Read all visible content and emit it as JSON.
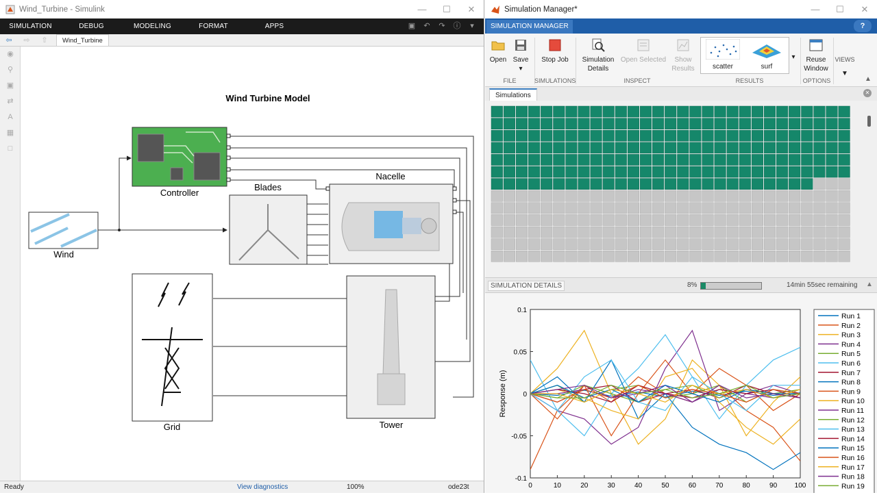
{
  "simulink": {
    "title": "Wind_Turbine - Simulink",
    "tabs": [
      "SIMULATION",
      "DEBUG",
      "MODELING",
      "FORMAT",
      "APPS"
    ],
    "breadcrumb": "Wind_Turbine",
    "model_title": "Wind Turbine Model",
    "blocks": {
      "controller": "Controller",
      "blades": "Blades",
      "nacelle": "Nacelle",
      "wind": "Wind",
      "grid": "Grid",
      "tower": "Tower"
    },
    "status": {
      "ready": "Ready",
      "diagnostics": "View diagnostics",
      "zoom": "100%",
      "solver": "ode23t"
    }
  },
  "simmgr": {
    "title": "Simulation Manager*",
    "tab": "SIMULATION MANAGER",
    "help": "?",
    "ribbon": {
      "open": "Open",
      "save": "Save",
      "stop_job": "Stop Job",
      "simulation_details_1": "Simulation",
      "simulation_details_2": "Details",
      "open_selected": "Open Selected",
      "show_results_1": "Show",
      "show_results_2": "Results",
      "scatter": "scatter",
      "surf": "surf",
      "reuse_window_1": "Reuse",
      "reuse_window_2": "Window",
      "views": "VIEWS",
      "groups": {
        "file": "FILE",
        "simulations": "SIMULATIONS",
        "inspect": "INSPECT",
        "results": "RESULTS",
        "options": "OPTIONS"
      }
    },
    "simulations_tab": "Simulations",
    "grid": {
      "rows": 13,
      "cols": 29,
      "completed": 200,
      "done_color": "#15876a",
      "pending_color": "#c6c6c6"
    },
    "details": {
      "label": "SIMULATION DETAILS",
      "percent_text": "8%",
      "progress": 0.08,
      "remaining": "14min 55sec remaining"
    }
  },
  "chart_data": {
    "type": "line",
    "title": "",
    "xlabel": "",
    "ylabel": "Response (m)",
    "xlim": [
      0,
      100
    ],
    "ylim": [
      -0.1,
      0.1
    ],
    "xticks": [
      "0",
      "10",
      "20",
      "30",
      "40",
      "50",
      "60",
      "70",
      "80",
      "90",
      "100"
    ],
    "yticks": [
      "0.1",
      "0.05",
      "0",
      "-0.05",
      "-0.1"
    ],
    "legend_position": "right",
    "series": [
      {
        "name": "Run 1",
        "color": "#0072bd",
        "x": [
          0,
          10,
          20,
          30,
          40,
          50,
          60,
          70,
          80,
          90,
          100
        ],
        "values": [
          0.0,
          -0.002,
          0.004,
          -0.003,
          0.002,
          -0.004,
          0.003,
          -0.002,
          0.003,
          -0.002,
          0.001
        ]
      },
      {
        "name": "Run 2",
        "color": "#d95319",
        "x": [
          0,
          10,
          20,
          30,
          40,
          50,
          60,
          70,
          80,
          90,
          100
        ],
        "values": [
          -0.09,
          -0.02,
          0.01,
          -0.01,
          0.02,
          0.0,
          -0.01,
          0.01,
          -0.02,
          -0.04,
          -0.08
        ]
      },
      {
        "name": "Run 3",
        "color": "#edb120",
        "x": [
          0,
          10,
          20,
          30,
          40,
          50,
          60,
          70,
          80,
          90,
          100
        ],
        "values": [
          0.0,
          0.03,
          0.075,
          0.0,
          -0.06,
          -0.03,
          0.04,
          0.01,
          -0.05,
          -0.01,
          0.02
        ]
      },
      {
        "name": "Run 4",
        "color": "#7e2f8e",
        "x": [
          0,
          10,
          20,
          30,
          40,
          50,
          60,
          70,
          80,
          90,
          100
        ],
        "values": [
          0.0,
          -0.02,
          -0.03,
          -0.06,
          -0.04,
          0.03,
          0.075,
          -0.02,
          0.0,
          0.01,
          0.0
        ]
      },
      {
        "name": "Run 5",
        "color": "#77ac30",
        "x": [
          0,
          10,
          20,
          30,
          40,
          50,
          60,
          70,
          80,
          90,
          100
        ],
        "values": [
          0.0,
          0.01,
          -0.01,
          0.005,
          0.01,
          -0.005,
          0.0,
          0.01,
          -0.01,
          0.005,
          0.0
        ]
      },
      {
        "name": "Run 6",
        "color": "#4dbeee",
        "x": [
          0,
          10,
          20,
          30,
          40,
          50,
          60,
          70,
          80,
          90,
          100
        ],
        "values": [
          0.04,
          -0.02,
          -0.05,
          0.0,
          0.03,
          0.07,
          0.02,
          -0.03,
          0.01,
          0.04,
          0.055
        ]
      },
      {
        "name": "Run 7",
        "color": "#a2142f",
        "x": [
          0,
          10,
          20,
          30,
          40,
          50,
          60,
          70,
          80,
          90,
          100
        ],
        "values": [
          0.0,
          -0.01,
          0.005,
          0.01,
          -0.01,
          0.0,
          0.005,
          -0.005,
          0.01,
          0.0,
          -0.005
        ]
      },
      {
        "name": "Run 8",
        "color": "#0072bd",
        "x": [
          0,
          10,
          20,
          30,
          40,
          50,
          60,
          70,
          80,
          90,
          100
        ],
        "values": [
          0.0,
          0.02,
          -0.01,
          0.04,
          -0.03,
          0.0,
          -0.04,
          -0.06,
          -0.07,
          -0.09,
          -0.07
        ]
      },
      {
        "name": "Run 9",
        "color": "#d95319",
        "x": [
          0,
          10,
          20,
          30,
          40,
          50,
          60,
          70,
          80,
          90,
          100
        ],
        "values": [
          0.0,
          -0.03,
          0.01,
          -0.05,
          0.0,
          0.04,
          0.0,
          0.03,
          0.01,
          -0.02,
          0.0
        ]
      },
      {
        "name": "Run 10",
        "color": "#edb120",
        "x": [
          0,
          10,
          20,
          30,
          40,
          50,
          60,
          70,
          80,
          90,
          100
        ],
        "values": [
          0.0,
          0.005,
          -0.005,
          -0.02,
          -0.03,
          0.02,
          0.03,
          -0.01,
          -0.04,
          -0.06,
          -0.03
        ]
      },
      {
        "name": "Run 11",
        "color": "#7e2f8e",
        "x": [
          0,
          10,
          20,
          30,
          40,
          50,
          60,
          70,
          80,
          90,
          100
        ],
        "values": [
          0.0,
          0.0,
          0.005,
          -0.005,
          0.0,
          0.01,
          -0.01,
          0.005,
          0.0,
          -0.005,
          0.0
        ]
      },
      {
        "name": "Run 12",
        "color": "#77ac30",
        "x": [
          0,
          10,
          20,
          30,
          40,
          50,
          60,
          70,
          80,
          90,
          100
        ],
        "values": [
          0.0,
          -0.005,
          0.01,
          0.0,
          -0.01,
          0.005,
          0.01,
          -0.005,
          0.005,
          0.0,
          0.005
        ]
      },
      {
        "name": "Run 13",
        "color": "#4dbeee",
        "x": [
          0,
          10,
          20,
          30,
          40,
          50,
          60,
          70,
          80,
          90,
          100
        ],
        "values": [
          0.0,
          -0.02,
          0.02,
          0.04,
          -0.01,
          -0.02,
          0.02,
          0.0,
          -0.02,
          0.01,
          0.01
        ]
      },
      {
        "name": "Run 14",
        "color": "#a2142f",
        "x": [
          0,
          10,
          20,
          30,
          40,
          50,
          60,
          70,
          80,
          90,
          100
        ],
        "values": [
          0.0,
          0.005,
          0.0,
          -0.01,
          0.01,
          0.0,
          -0.005,
          0.005,
          0.0,
          0.005,
          -0.005
        ]
      },
      {
        "name": "Run 15",
        "color": "#0072bd",
        "x": [
          0,
          10,
          20,
          30,
          40,
          50,
          60,
          70,
          80,
          90,
          100
        ],
        "values": [
          0.0,
          0.01,
          -0.005,
          0.005,
          -0.01,
          0.01,
          0.0,
          -0.01,
          0.005,
          0.0,
          0.0
        ]
      },
      {
        "name": "Run 16",
        "color": "#d95319",
        "x": [
          0,
          10,
          20,
          30,
          40,
          50,
          60,
          70,
          80,
          90,
          100
        ],
        "values": [
          0.0,
          -0.01,
          0.005,
          -0.005,
          0.01,
          -0.005,
          0.005,
          0.0,
          -0.01,
          0.005,
          0.0
        ]
      },
      {
        "name": "Run 17",
        "color": "#edb120",
        "x": [
          0,
          10,
          20,
          30,
          40,
          50,
          60,
          70,
          80,
          90,
          100
        ],
        "values": [
          0.0,
          0.0,
          -0.01,
          0.005,
          0.0,
          -0.01,
          0.01,
          0.0,
          0.005,
          -0.005,
          0.005
        ]
      },
      {
        "name": "Run 18",
        "color": "#7e2f8e",
        "x": [
          0,
          10,
          20,
          30,
          40,
          50,
          60,
          70,
          80,
          90,
          100
        ],
        "values": [
          0.0,
          0.005,
          0.01,
          -0.005,
          0.005,
          0.0,
          -0.01,
          0.01,
          -0.005,
          0.0,
          -0.005
        ]
      },
      {
        "name": "Run 19",
        "color": "#77ac30",
        "x": [
          0,
          10,
          20,
          30,
          40,
          50,
          60,
          70,
          80,
          90,
          100
        ],
        "values": [
          0.0,
          -0.005,
          -0.005,
          0.01,
          0.0,
          0.005,
          -0.005,
          0.0,
          0.01,
          -0.005,
          0.0
        ]
      }
    ]
  }
}
